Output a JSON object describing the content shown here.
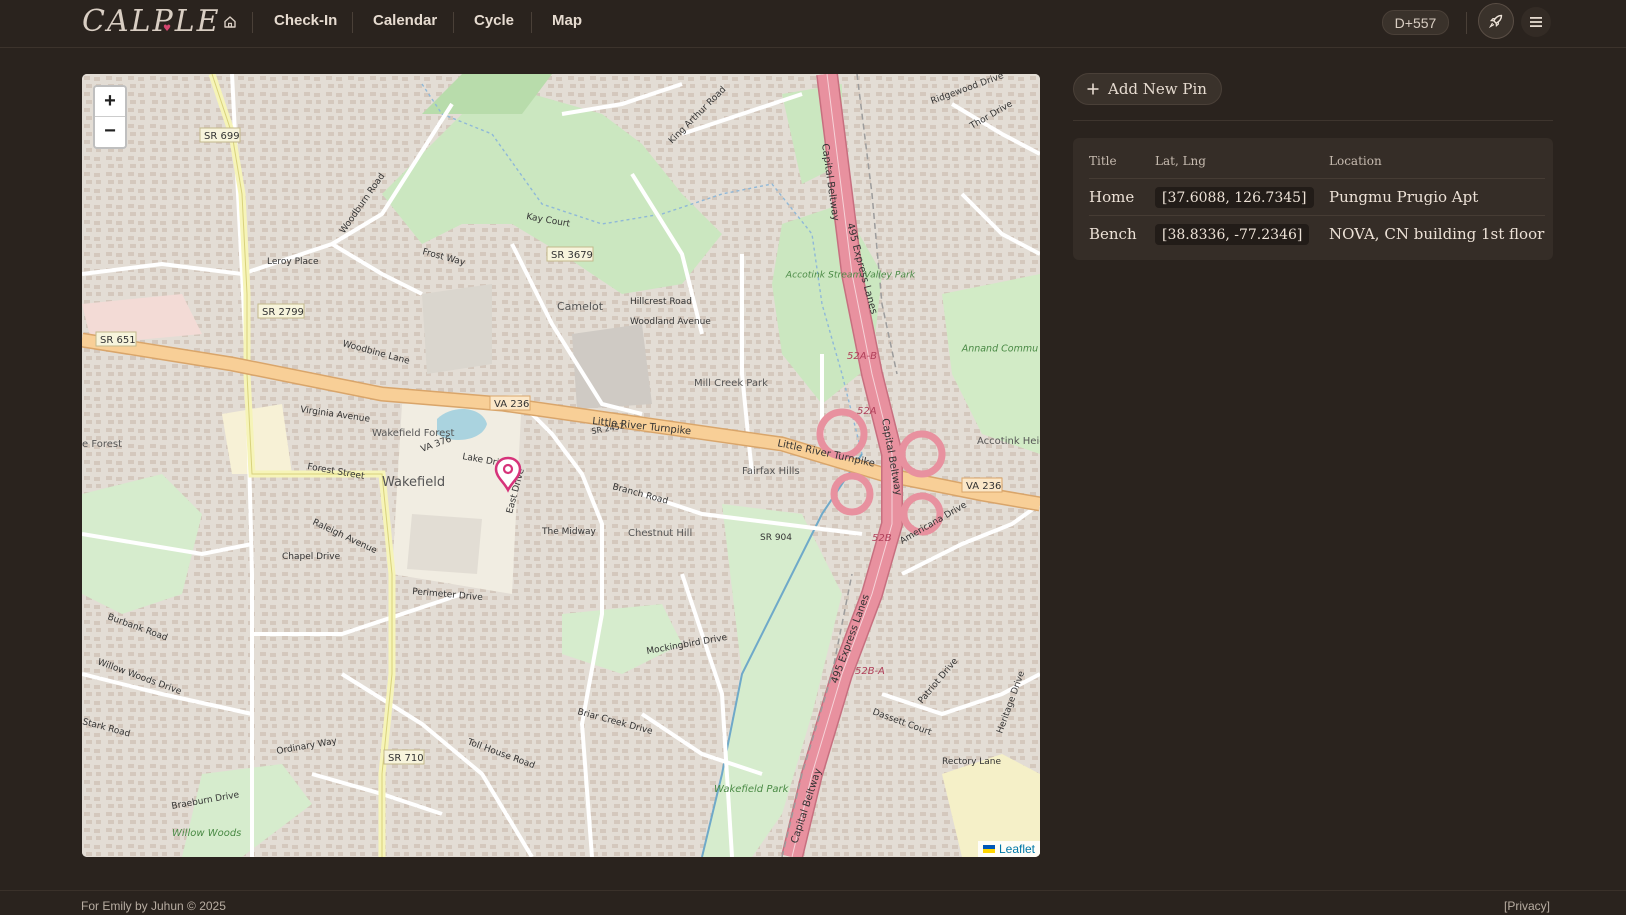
{
  "header": {
    "logo_text": "CALPLE",
    "nav": [
      {
        "label": "Check-In"
      },
      {
        "label": "Calendar"
      },
      {
        "label": "Cycle"
      },
      {
        "label": "Map"
      }
    ],
    "dday_badge": "D+557",
    "icons": {
      "home": "home-icon",
      "rocket": "rocket-icon",
      "menu": "hamburger-menu-icon"
    }
  },
  "map": {
    "zoom_in": "+",
    "zoom_out": "−",
    "attribution": "Leaflet",
    "labels": {
      "sr699": "SR 699",
      "sr3679": "SR 3679",
      "sr2799": "SR 2799",
      "sr651": "SR 651",
      "va236a": "VA 236",
      "va236b": "VA 236",
      "sr710": "SR 710",
      "little_river_1": "Little River Turnpike",
      "little_river_2": "Little River Turnpike",
      "capital_beltway_1": "Capital Beltway",
      "capital_beltway_2": "Capital Beltway",
      "capital_beltway_3": "Capital Beltway",
      "express_lanes_1": "495 Express Lanes",
      "express_lanes_2": "495 Express Lanes",
      "wakefield": "Wakefield",
      "wakefield_forest": "Wakefield Forest",
      "camelot": "Camelot",
      "mill_creek_park": "Mill Creek Park",
      "fairfax_hills": "Fairfax Hills",
      "chestnut_hill": "Chestnut Hill",
      "accotink_stream": "Accotink Stream Valley Park",
      "wakefield_park": "Wakefield Park",
      "willow_woods": "Willow Woods",
      "annandale": "Annand Commu Park",
      "accotink_heig": "Accotink Heig",
      "lake_forest": "e Forest",
      "exit_52a": "52A",
      "exit_52ab": "52A-B",
      "exit_52b": "52B",
      "exit_52ba": "52B-A",
      "leroy_place": "Leroy Place",
      "frost_way": "Frost Way",
      "lake_drive": "Lake Drive",
      "perimeter_drive": "Perimeter Drive",
      "chapel_drive": "Chapel Drive",
      "forest_street": "Forest Street",
      "raleigh_avenue": "Raleigh Avenue",
      "virginia_avenue": "Virginia Avenue",
      "woodbine_lane": "Woodbine Lane",
      "hillcrest_road": "Hillcrest Road",
      "woodland_avenue": "Woodland Avenue",
      "the_midway": "The Midway",
      "branch_road": "Branch Road",
      "briar_creek": "Briar Creek Drive",
      "braeburn": "Braeburn Drive",
      "toll_house": "Toll House Road",
      "mockingbird": "Mockingbird Drive",
      "americana": "Americana Drive",
      "rectory_lane": "Rectory Lane",
      "ordinary_way": "Ordinary Way",
      "burbank_road": "Burbank Road",
      "willow_woods_drive": "Willow Woods Drive",
      "stark_road": "Stark Road",
      "kay_court": "Kay Court",
      "woodburn_road": "Woodburn Road",
      "king_arthur": "King Arthur Road",
      "ridgewood": "Ridgewood Drive",
      "thor_drive": "Thor Drive",
      "sr904": "SR 904",
      "va376": "VA 376",
      "east_drive": "East Drive",
      "dassett": "Dassett Court",
      "patriot": "Patriot Drive",
      "heritage": "Heritage Drive",
      "sr2452": "SR 2452"
    }
  },
  "pins_panel": {
    "add_button": "Add New Pin",
    "columns": [
      "Title",
      "Lat, Lng",
      "Location"
    ],
    "rows": [
      {
        "title": "Home",
        "latlng": "[37.6088, 126.7345]",
        "location": "Pungmu Prugio Apt"
      },
      {
        "title": "Bench",
        "latlng": "[38.8336, -77.2346]",
        "location": "NOVA, CN building 1st floor"
      }
    ]
  },
  "footer": {
    "credit": "For Emily by Juhun © 2025",
    "privacy": "[Privacy]"
  },
  "colors": {
    "background": "#2a231e",
    "accent_pin": "#d6337a",
    "highway": "#e8919f",
    "primary_road": "#f4c58a"
  }
}
